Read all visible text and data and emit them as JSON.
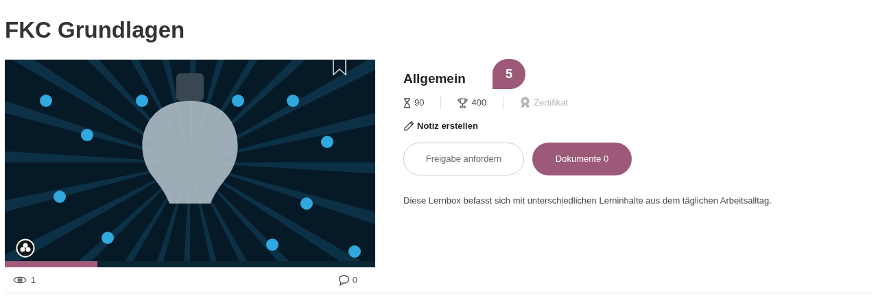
{
  "title": "FKC Grundlagen",
  "card": {
    "progress": {
      "level": 0.25
    },
    "views": "1",
    "comments": "0"
  },
  "details": {
    "heading": "Allgemein",
    "badge": "5",
    "stats": [
      {
        "kind": "duration",
        "value": "90",
        "disabled": false
      },
      {
        "kind": "points",
        "value": "400",
        "disabled": false
      },
      {
        "kind": "certificate",
        "value": "Zertifikat",
        "disabled": true
      }
    ],
    "note_link": "Notiz erstellen",
    "buttons": [
      {
        "label": "Freigabe anfordern",
        "kind": "outline"
      },
      {
        "label": "Dokumente 0",
        "kind": "filled"
      }
    ],
    "description": "Diese Lernbox befasst sich mit unterschiedlichen Lerninhalte aus dem täglichen Arbeitsalltag."
  }
}
